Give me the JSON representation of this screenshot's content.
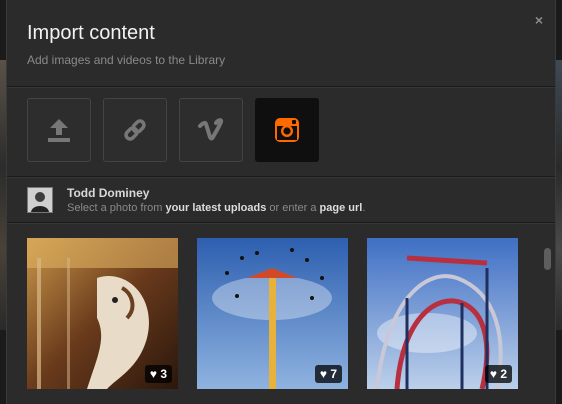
{
  "dialog": {
    "title": "Import content",
    "subtitle": "Add images and videos to the Library",
    "close_glyph": "×"
  },
  "sources": [
    {
      "icon": "upload-icon",
      "active": false
    },
    {
      "icon": "link-icon",
      "active": false
    },
    {
      "icon": "vimeo-icon",
      "active": false
    },
    {
      "icon": "instagram-icon",
      "active": true,
      "accent": "#ff6a00"
    }
  ],
  "user": {
    "name": "Todd Dominey",
    "hint_before": "Select a photo from ",
    "hint_link1": "your latest uploads",
    "hint_middle": " or enter a ",
    "hint_link2": "page url",
    "hint_after": "."
  },
  "photos": [
    {
      "subject": "carousel horse",
      "likes": "♥ 3"
    },
    {
      "subject": "swing ride tower",
      "likes": "♥ 7"
    },
    {
      "subject": "roller coaster",
      "likes": "♥ 2"
    }
  ]
}
